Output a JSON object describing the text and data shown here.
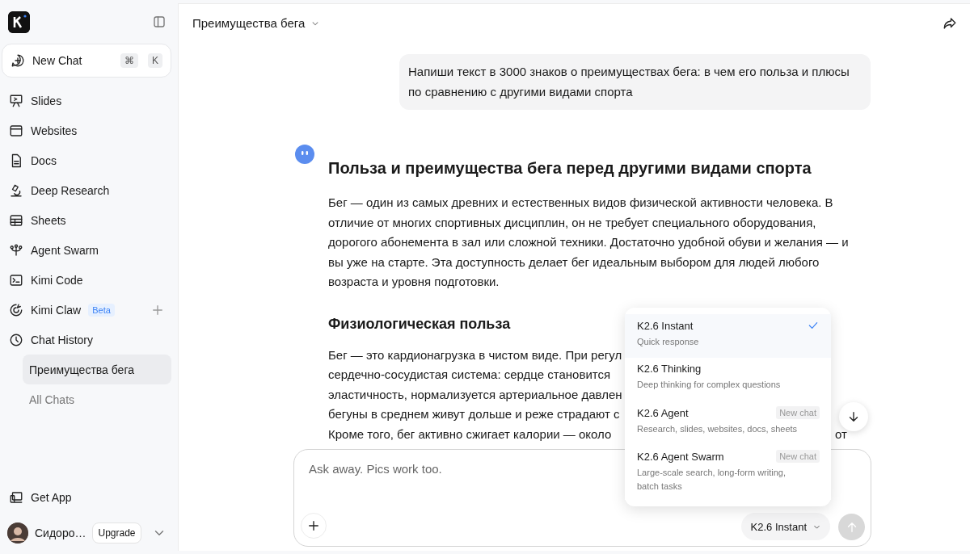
{
  "sidebar": {
    "new_chat": {
      "label": "New Chat",
      "keys": [
        "⌘",
        "K"
      ]
    },
    "items": [
      {
        "label": "Slides"
      },
      {
        "label": "Websites"
      },
      {
        "label": "Docs"
      },
      {
        "label": "Deep Research"
      },
      {
        "label": "Sheets"
      },
      {
        "label": "Agent Swarm"
      },
      {
        "label": "Kimi Code"
      },
      {
        "label": "Kimi Claw",
        "badge": "Beta"
      },
      {
        "label": "Chat History",
        "children": [
          {
            "label": "Преимущества бега",
            "selected": true
          }
        ]
      }
    ],
    "all_chats": "All Chats",
    "get_app": "Get App",
    "user": {
      "name": "Сидоро…",
      "upgrade": "Upgrade"
    }
  },
  "chat": {
    "title": "Преимущества бега",
    "user_message": "Напиши текст в 3000 знаков о преимуществах бега: в чем его польза и плюсы по сравнению с другими видами спорта",
    "heading": "Польза и преимущества бега перед другими видами спорта",
    "paragraph": "Бег — один из самых древних и естественных видов физической активности человека. В отличие от многих спортивных дисциплин, он не требует специального оборудования, дорогого абонемента в зал или сложной техники. Достаточно удобной обуви и желания — и вы уже на старте. Эта доступность делает бег идеальным выбором для людей любого возраста и уровня подготовки.",
    "subheading": "Физиологическая польза",
    "covered_lines": [
      {
        "text": "Бег — это кардионагрузка в чистом виде. При регул"
      },
      {
        "text": "сердечно-сосудистая система: сердце становится"
      },
      {
        "text": "эластичность, нормализуется артериальное давлен"
      },
      {
        "text": "бегуны в среднем живут дольше и реже страдают с"
      },
      {
        "text": "Кроме того, бег активно сжигает калории — около",
        "tail": "от"
      }
    ]
  },
  "composer": {
    "placeholder": "Ask away. Pics work too.",
    "model": "K2.6 Instant"
  },
  "model_menu": [
    {
      "name": "K2.6 Instant",
      "description": "Quick response",
      "selected": true
    },
    {
      "name": "K2.6 Thinking",
      "description": "Deep thinking for complex questions",
      "selected": false
    },
    {
      "name": "K2.6 Agent",
      "description": "Research, slides, websites, docs, sheets",
      "selected": false,
      "badge": "New chat"
    },
    {
      "name": "K2.6 Agent Swarm",
      "description": "Large-scale search, long-form writing, batch tasks",
      "selected": false,
      "badge": "New chat"
    }
  ]
}
